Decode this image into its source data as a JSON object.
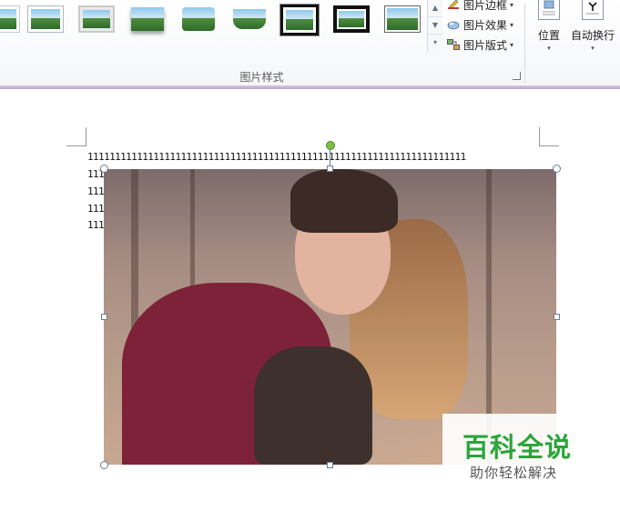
{
  "ribbon": {
    "group_label": "图片样式",
    "picture_tools": [
      {
        "label": "图片边框",
        "icon": "pencil-border-icon"
      },
      {
        "label": "图片效果",
        "icon": "picture-effects-icon"
      },
      {
        "label": "图片版式",
        "icon": "picture-layout-icon"
      }
    ],
    "arrange": [
      {
        "label": "位置",
        "icon": "position-icon"
      },
      {
        "label": "自动换行",
        "icon": "wrap-text-icon"
      }
    ],
    "gallery_scroll": {
      "up": "▲",
      "down": "▼",
      "more": "▾"
    },
    "dropdown_glyph": "▾"
  },
  "document": {
    "text_lines": [
      "111111111111111111111111111111111111111111111111111111111111111111111",
      "111",
      "111",
      "111",
      "111"
    ]
  },
  "watermark": {
    "title": "百科全说",
    "subtitle": "助你轻松解决",
    "title_color": "#2aa53a"
  }
}
